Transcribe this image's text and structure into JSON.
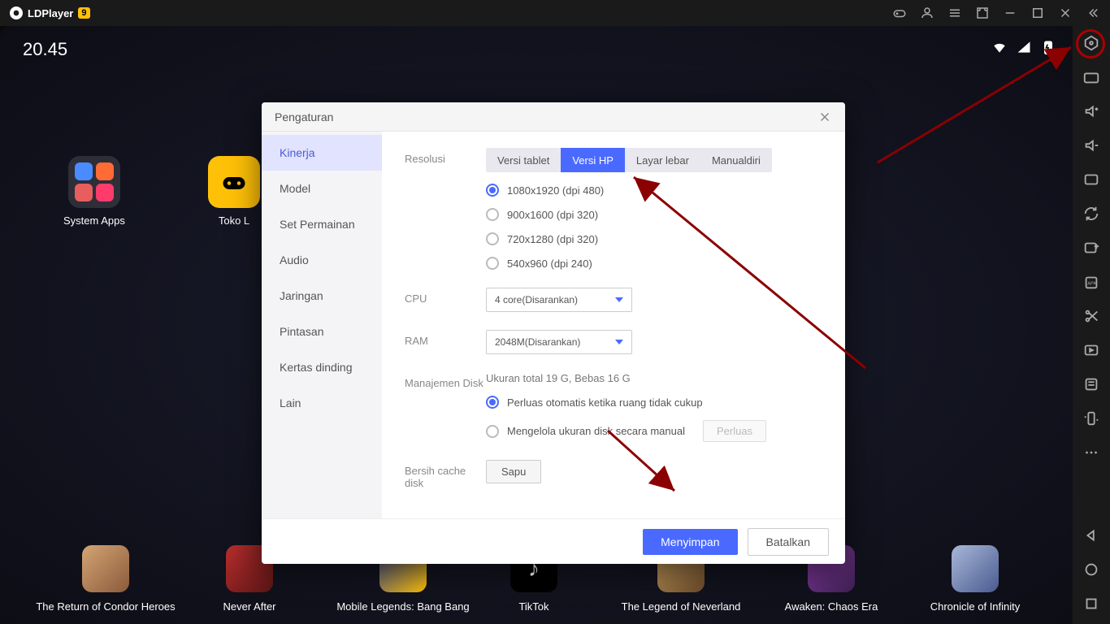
{
  "app_name": "LDPlayer",
  "app_badge": "9",
  "time": "20.45",
  "desktop_apps": {
    "system_apps": "System Apps",
    "toko": "Toko L"
  },
  "dock": [
    "The Return of Condor Heroes",
    "Never After",
    "Mobile Legends: Bang Bang",
    "TikTok",
    "The Legend of Neverland",
    "Awaken: Chaos Era",
    "Chronicle of Infinity"
  ],
  "modal": {
    "title": "Pengaturan",
    "sidebar": [
      "Kinerja",
      "Model",
      "Set Permainan",
      "Audio",
      "Jaringan",
      "Pintasan",
      "Kertas dinding",
      "Lain"
    ],
    "labels": {
      "resolusi": "Resolusi",
      "cpu": "CPU",
      "ram": "RAM",
      "disk": "Manajemen Disk",
      "cache": "Bersih cache disk"
    },
    "res_tabs": [
      "Versi tablet",
      "Versi HP",
      "Layar lebar",
      "Manualdiri"
    ],
    "res_options": [
      "1080x1920  (dpi 480)",
      "900x1600  (dpi 320)",
      "720x1280  (dpi 320)",
      "540x960  (dpi 240)"
    ],
    "cpu_value": "4 core(Disarankan)",
    "ram_value": "2048M(Disarankan)",
    "disk_info": "Ukuran total 19 G,  Bebas 16 G",
    "disk_options": {
      "auto": "Perluas otomatis ketika ruang tidak cukup",
      "manual": "Mengelola ukuran disk secara manual",
      "manual_btn": "Perluas"
    },
    "cache_btn": "Sapu",
    "save": "Menyimpan",
    "cancel": "Batalkan"
  }
}
